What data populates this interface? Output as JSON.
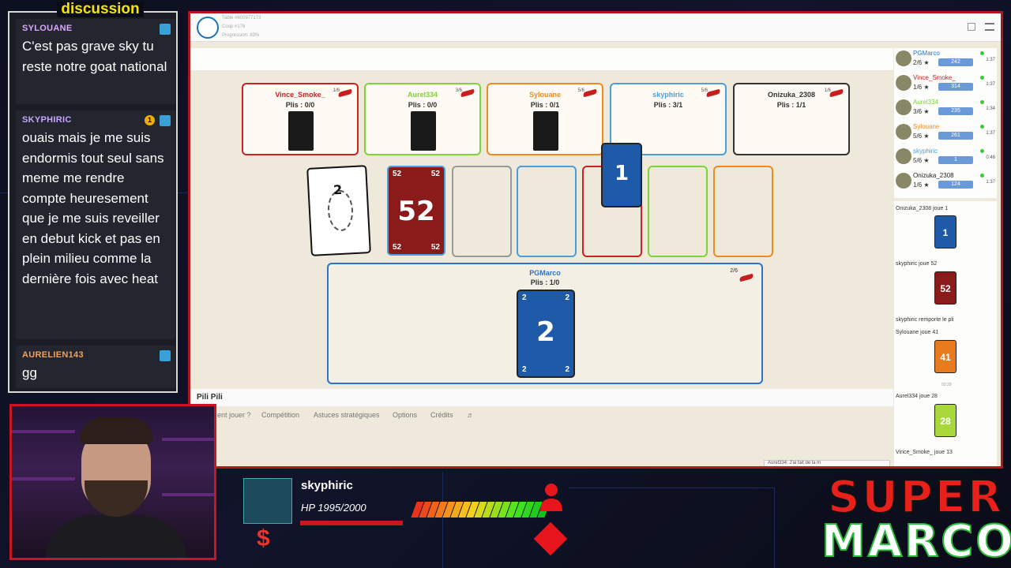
{
  "chat": {
    "title": "discussion",
    "messages": [
      {
        "user": "SYLOUANE",
        "color": "#d9a8ff",
        "text": "C'est pas grave sky tu reste notre goat national"
      },
      {
        "user": "SKYPHIRIC",
        "color": "#c7a6ff",
        "text": "ouais mais je me suis endormis tout seul sans meme me rendre compte heuresement que je me suis reveiller en debut kick et pas en plein milieu comme la dernière fois avec heat",
        "coin": "1"
      },
      {
        "user": "AURELIEN143",
        "color": "#f0a060",
        "text": "gg"
      }
    ]
  },
  "game": {
    "table_info": [
      "Table #600977173",
      "Coup #176",
      "Progression: 83%"
    ],
    "seats": [
      {
        "name": "Vince_Smoke_",
        "plis": "Plis : 0/0",
        "count": "1/6",
        "color": "#cc2222"
      },
      {
        "name": "Aurel334",
        "plis": "Plis : 0/0",
        "count": "3/6",
        "color": "#7ed23a"
      },
      {
        "name": "Sylouane",
        "plis": "Plis : 0/1",
        "count": "5/6",
        "color": "#f08a1e"
      },
      {
        "name": "skyphiric",
        "plis": "Plis : 3/1",
        "count": "5/6",
        "color": "#4a9fd8"
      },
      {
        "name": "Onizuka_2308",
        "plis": "Plis : 1/1",
        "count": "1/6",
        "color": "#222222"
      }
    ],
    "center_cards": {
      "rule_card": "2",
      "played": "52",
      "floating": "1"
    },
    "me": {
      "name": "PGMarco",
      "plis": "Plis : 1/0",
      "count": "2/6",
      "card": "2"
    },
    "footer_title": "Pili Pili",
    "menu": [
      "ent jouer ?",
      "Compétition",
      "Astuces stratégiques",
      "Options",
      "Crédits",
      "♬"
    ]
  },
  "sidebar": {
    "players": [
      {
        "name": "PGMarco",
        "stat": "2/6 ★",
        "pts": "242",
        "time": "1:37",
        "color": "#2d73c8"
      },
      {
        "name": "Vince_Smoke_",
        "stat": "1/6 ★",
        "pts": "314",
        "time": "1:37",
        "color": "#cc2222"
      },
      {
        "name": "Aurel334",
        "stat": "3/6 ★",
        "pts": "235",
        "time": "1:34",
        "color": "#7ed23a"
      },
      {
        "name": "Sylouane",
        "stat": "5/6 ★",
        "pts": "261",
        "time": "1:37",
        "color": "#f08a1e"
      },
      {
        "name": "skyphiric",
        "stat": "5/6 ★",
        "pts": "1",
        "time": "0:46",
        "color": "#4a9fd8"
      },
      {
        "name": "Onizuka_2308",
        "stat": "1/6 ★",
        "pts": "124",
        "time": "1:37",
        "color": "#222222"
      }
    ],
    "log": [
      {
        "text": "Onizuka_2308 joue 1",
        "card": "1",
        "cardcolor": "#1f5aa8"
      },
      {
        "text": "skyphiric joue 52",
        "card": "52",
        "cardcolor": "#8b1a1a"
      },
      {
        "text": "skyphiric remporte le pli"
      },
      {
        "text": "Sylouane joue 41",
        "card": "41",
        "cardcolor": "#e87b1e"
      },
      {
        "text": "02:29"
      },
      {
        "text": "Aurel334 joue 28",
        "card": "28",
        "cardcolor": "#a8d83a"
      },
      {
        "text": "Vince_Smoke_ joue 13"
      }
    ],
    "chat_preview": "Aurel334: J'ai fait de la m"
  },
  "overlay": {
    "hp_name": "skyphiric",
    "hp_text": "HP 1995/2000",
    "hp_fraction": 0.9975,
    "dollar": "$",
    "brand_line1": "SUPER",
    "brand_line2": "MARCO"
  }
}
